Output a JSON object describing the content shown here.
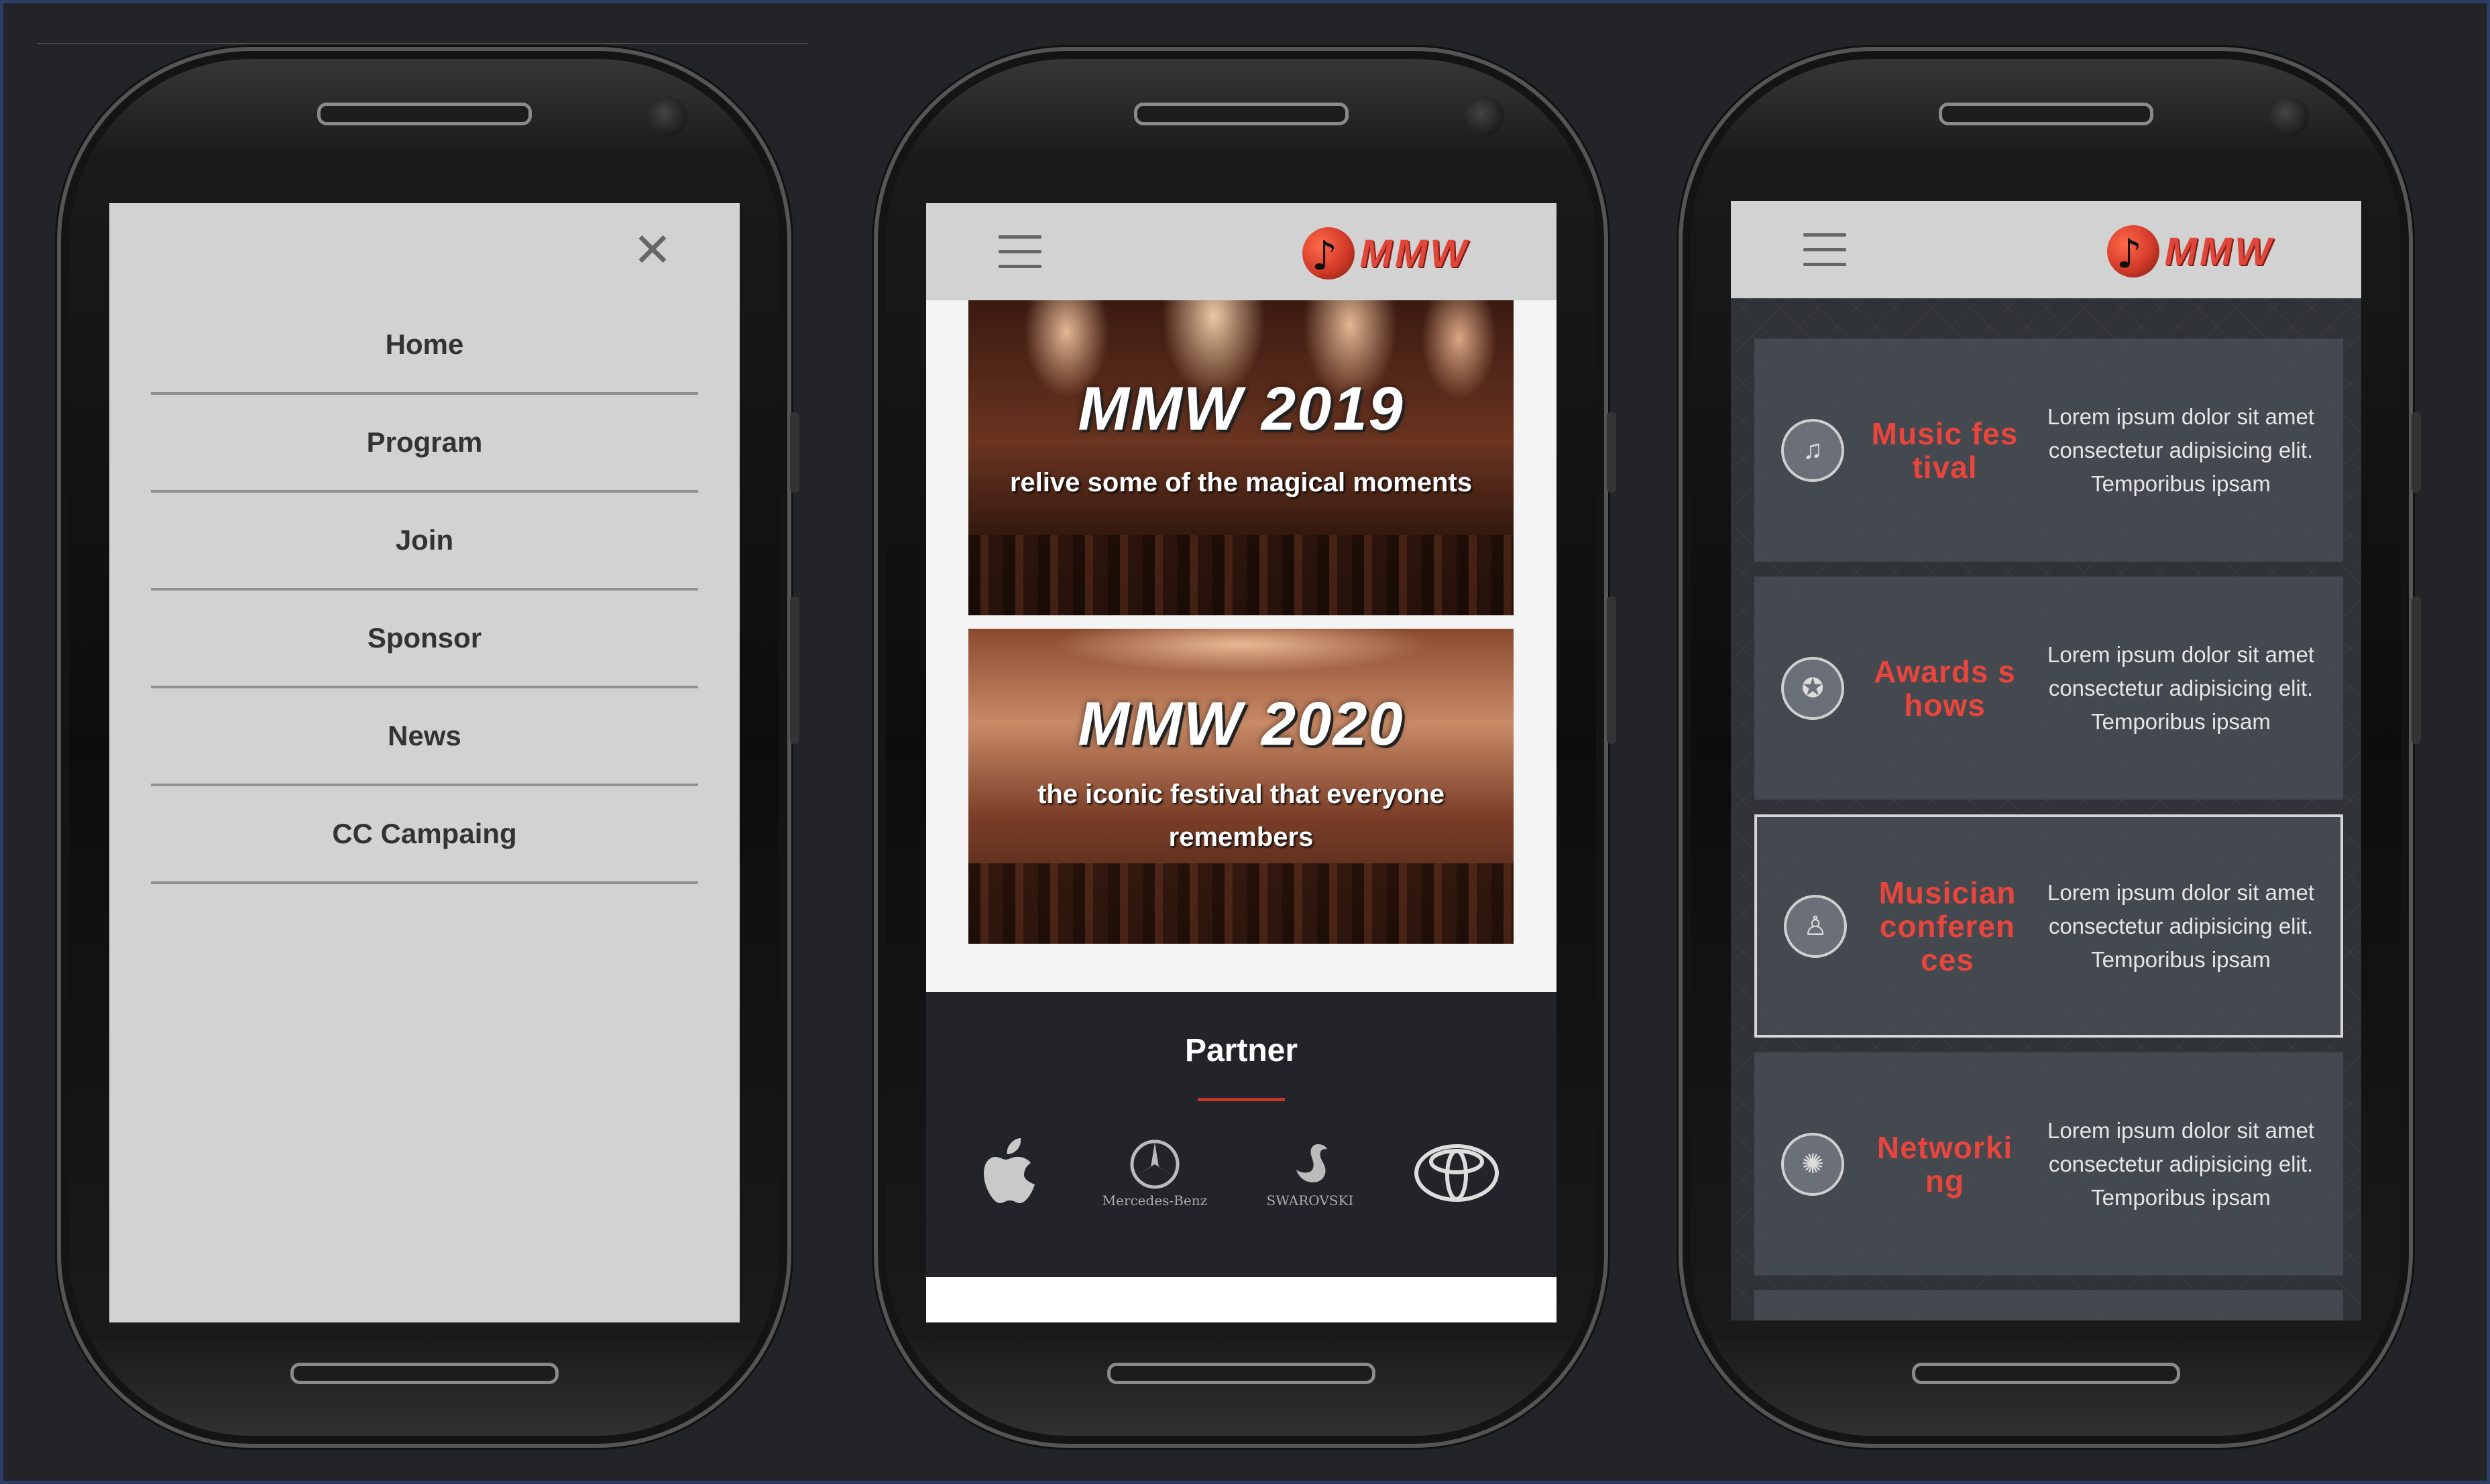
{
  "menu": {
    "close_icon": "close-icon",
    "items": [
      {
        "label": "Home"
      },
      {
        "label": "Program"
      },
      {
        "label": "Join"
      },
      {
        "label": "Sponsor"
      },
      {
        "label": "News"
      },
      {
        "label": "CC Campaing"
      }
    ]
  },
  "header": {
    "logo_text": "MMW",
    "menu_icon": "hamburger-menu-icon",
    "logo_icon": "music-note-disc-icon",
    "accent_color": "#e0463a"
  },
  "events": [
    {
      "title": "MMW 2019",
      "subtitle": "relive some of the magical moments"
    },
    {
      "title": "MMW 2020",
      "subtitle": "the iconic festival that everyone remembers"
    }
  ],
  "partners": {
    "title": "Partner",
    "logos": [
      {
        "name": "apple-logo",
        "label": ""
      },
      {
        "name": "mercedes-benz-logo",
        "label": "Mercedes-Benz"
      },
      {
        "name": "swarovski-logo",
        "label": "SWAROVSKI"
      },
      {
        "name": "toyota-logo",
        "label": ""
      }
    ]
  },
  "services": [
    {
      "title": "Music festival",
      "icon": "music-festival-icon",
      "desc": "Lorem ipsum dolor sit amet consectetur adipisicing elit. Temporibus ipsam",
      "active": false
    },
    {
      "title": "Awards shows",
      "icon": "award-medal-icon",
      "desc": "Lorem ipsum dolor sit amet consectetur adipisicing elit. Temporibus ipsam",
      "active": false
    },
    {
      "title": "Musician conferences",
      "icon": "conference-people-icon",
      "desc": "Lorem ipsum dolor sit amet consectetur adipisicing elit. Temporibus ipsam",
      "active": true
    },
    {
      "title": "Networking",
      "icon": "network-people-icon",
      "desc": "Lorem ipsum dolor sit amet consectetur adipisicing elit. Temporibus ipsam",
      "active": false
    }
  ]
}
